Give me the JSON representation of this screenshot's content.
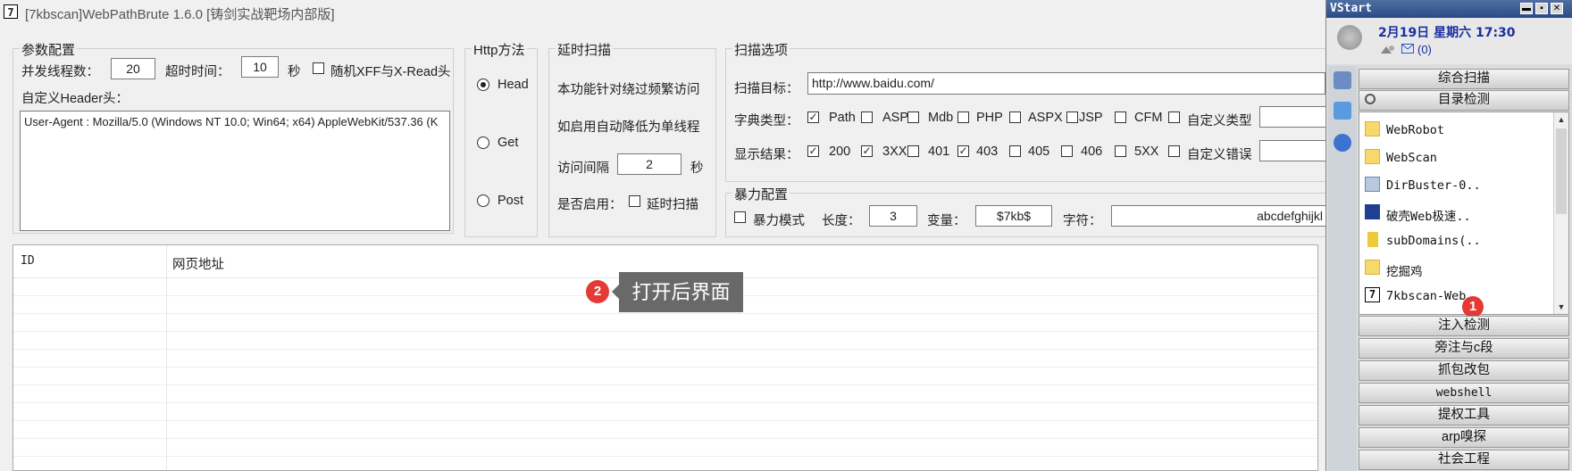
{
  "window": {
    "icon_glyph": "7",
    "title": "[7kbscan]WebPathBrute 1.6.0 [铸剑实战靶场内部版]"
  },
  "params": {
    "group_title": "参数配置",
    "threads_label": "并发线程数：",
    "threads_value": "20",
    "timeout_label": "超时时间：",
    "timeout_value": "10",
    "timeout_unit": "秒",
    "random_xff_label": "随机XFF与X-Read头",
    "header_label": "自定义Header头：",
    "header_value": "User-Agent : Mozilla/5.0 (Windows NT 10.0; Win64; x64) AppleWebKit/537.36 (K"
  },
  "http_method": {
    "group_title": "Http方法",
    "options": [
      "Head",
      "Get",
      "Post"
    ],
    "selected": "Head"
  },
  "delay": {
    "group_title": "延时扫描",
    "line1": "本功能针对绕过频繁访问",
    "line2": "如启用自动降低为单线程",
    "interval_label": "访问间隔",
    "interval_value": "2",
    "interval_unit": "秒",
    "enable_label": "是否启用：",
    "enable_checkbox_label": "延时扫描"
  },
  "scan_options": {
    "group_title": "扫描选项",
    "target_label": "扫描目标：",
    "target_value": "http://www.baidu.com/",
    "dict_label": "字典类型：",
    "dict_types": [
      {
        "label": "Path",
        "checked": true
      },
      {
        "label": "ASP",
        "checked": false
      },
      {
        "label": "Mdb",
        "checked": false
      },
      {
        "label": "PHP",
        "checked": false
      },
      {
        "label": "ASPX",
        "checked": false
      },
      {
        "label": "JSP",
        "checked": false
      },
      {
        "label": "CFM",
        "checked": false
      },
      {
        "label": "自定义类型",
        "checked": false
      }
    ],
    "show_label": "显示结果：",
    "show_results": [
      {
        "label": "200",
        "checked": true
      },
      {
        "label": "3XX",
        "checked": true
      },
      {
        "label": "401",
        "checked": false
      },
      {
        "label": "403",
        "checked": true
      },
      {
        "label": "405",
        "checked": false
      },
      {
        "label": "406",
        "checked": false
      },
      {
        "label": "5XX",
        "checked": false
      },
      {
        "label": "自定义错误",
        "checked": false
      }
    ]
  },
  "brute": {
    "group_title": "暴力配置",
    "mode_label": "暴力模式",
    "length_label": "长度：",
    "length_value": "3",
    "var_label": "变量：",
    "var_value": "$7kb$",
    "chars_label": "字符：",
    "chars_value": "abcdefghijkl"
  },
  "results_table": {
    "columns": [
      "ID",
      "网页地址"
    ]
  },
  "annotations": {
    "callout_text": "打开后界面",
    "badge_1": "1",
    "badge_2": "2"
  },
  "vstart": {
    "title": "VStart",
    "date": "2月19日 星期六 17:30",
    "mail_count": "(0)",
    "categories_top": [
      "综合扫描",
      "目录检测"
    ],
    "list_items": [
      "WebRobot",
      "WebScan",
      "DirBuster-0..",
      "破壳Web极速..",
      "subDomains(..",
      "挖掘鸡",
      "7kbscan-Web.."
    ],
    "categories_bottom": [
      "注入检测",
      "旁注与c段",
      "抓包改包",
      "webshell",
      "提权工具",
      "arp嗅探",
      "社会工程"
    ]
  }
}
